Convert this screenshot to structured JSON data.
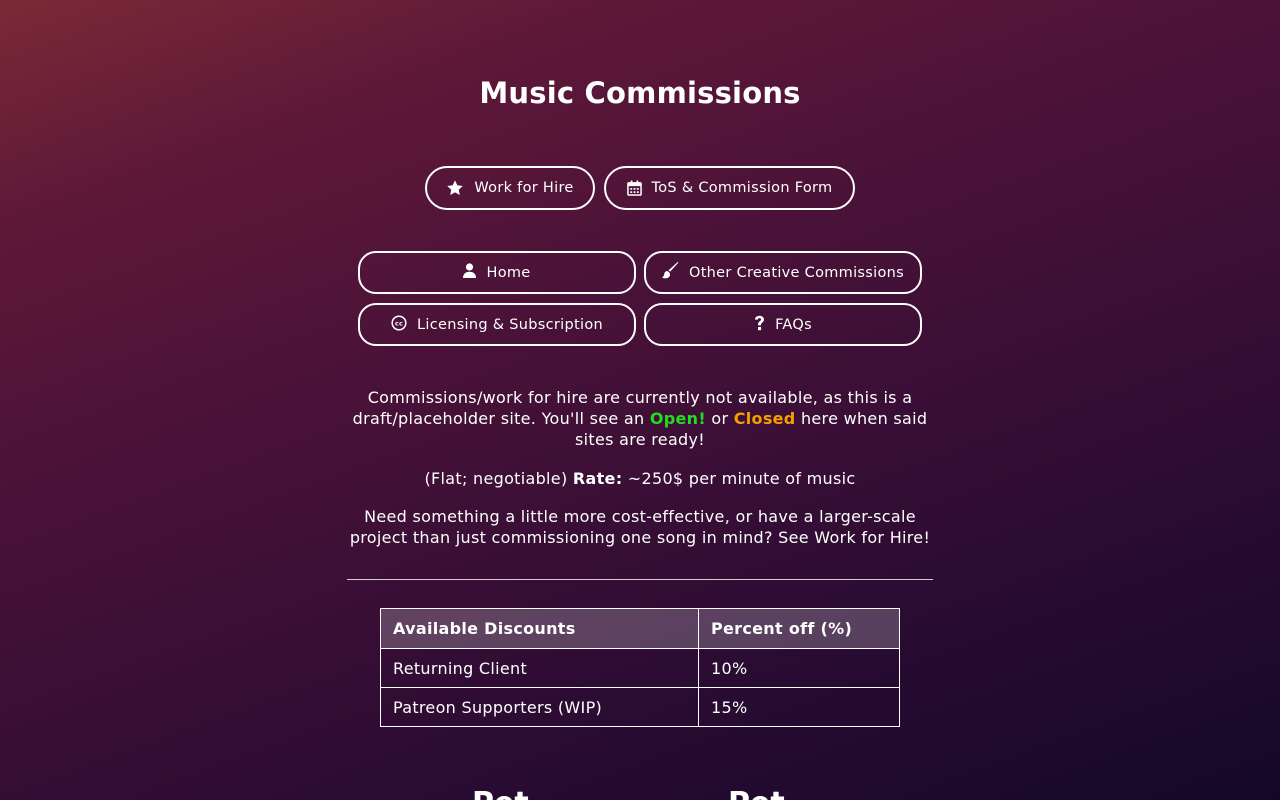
{
  "page": {
    "title": "Music Commissions"
  },
  "top_buttons": [
    {
      "label": "Work for Hire",
      "icon": "star-icon"
    },
    {
      "label": "ToS & Commission Form",
      "icon": "calendar-icon"
    }
  ],
  "nav": [
    {
      "label": "Home",
      "icon": "user-icon"
    },
    {
      "label": "Other Creative Commissions",
      "icon": "paintbrush-icon"
    },
    {
      "label": "Licensing & Subscription",
      "icon": "creative-commons-icon"
    },
    {
      "label": "FAQs",
      "icon": "question-icon"
    }
  ],
  "status": {
    "text_before": "Commissions/work for hire are currently not available, as this is a draft/placeholder site. You'll see an ",
    "open_label": "Open!",
    "text_mid": " or ",
    "closed_label": "Closed",
    "text_after": " here when said sites are ready!",
    "open_color": "#22dd22",
    "closed_color": "#f5a000"
  },
  "rate": {
    "prefix": "(Flat; negotiable) ",
    "label": "Rate:",
    "value": " ~250$ per minute of music"
  },
  "upsell": {
    "text": "Need something a little more cost-effective, or have a larger-scale project than just commissioning one song in mind? See Work for Hire!"
  },
  "discounts": {
    "headers": [
      "Available Discounts",
      "Percent off (%)"
    ],
    "rows": [
      [
        "Returning Client",
        "10%"
      ],
      [
        "Patreon Supporters (WIP)",
        "15%"
      ]
    ]
  },
  "bottom": {
    "heading_left": "Pet",
    "heading_right": "Pet"
  }
}
